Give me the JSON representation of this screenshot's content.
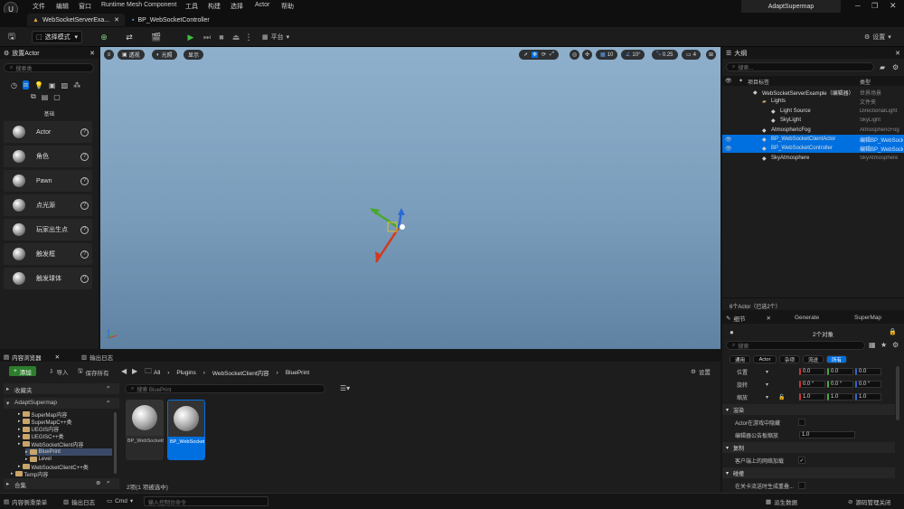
{
  "menu": {
    "items": [
      "文件",
      "编辑",
      "窗口",
      "Runtime Mesh Component",
      "工具",
      "构建",
      "选择",
      "Actor",
      "帮助"
    ],
    "project": "AdaptSupermap"
  },
  "tabs": {
    "level_tab": "WebSocketServerExa...",
    "blueprint_tab": "BP_WebSocketController"
  },
  "toolbar": {
    "select_mode": "选择模式",
    "platform": "平台",
    "settings": "设置"
  },
  "place_actors": {
    "title": "放置Actor",
    "search_placeholder": "搜索类",
    "category_label": "基础",
    "items": [
      {
        "label": "Actor",
        "icon": "sphere-icon"
      },
      {
        "label": "角色",
        "icon": "character-icon"
      },
      {
        "label": "Pawn",
        "icon": "pawn-icon"
      },
      {
        "label": "点光源",
        "icon": "point-light-icon"
      },
      {
        "label": "玩家出生点",
        "icon": "player-start-icon"
      },
      {
        "label": "触发框",
        "icon": "trigger-box-icon"
      },
      {
        "label": "触发球体",
        "icon": "trigger-sphere-icon"
      }
    ]
  },
  "viewport": {
    "view_mode": "透视",
    "lit_mode": "光照",
    "show": "显示",
    "grid_snap": "10",
    "rot_snap": "10°",
    "scale_snap": "0.25",
    "camera_speed": "4"
  },
  "outliner": {
    "title": "大纲",
    "search_placeholder": "搜索...",
    "col_label": "项目标签",
    "col_type": "类型",
    "rows": [
      {
        "name": "WebSocketServerExample（编辑器）",
        "type": "世界场景",
        "indent": 2,
        "selected": false,
        "visible": false
      },
      {
        "name": "Lights",
        "type": "文件夹",
        "indent": 3,
        "selected": false,
        "visible": false
      },
      {
        "name": "Light Source",
        "type": "DirectionalLight",
        "indent": 4,
        "selected": false,
        "visible": false
      },
      {
        "name": "SkyLight",
        "type": "SkyLight",
        "indent": 4,
        "selected": false,
        "visible": false
      },
      {
        "name": "AtmosphericFog",
        "type": "AtmosphericFog",
        "indent": 3,
        "selected": false,
        "visible": false
      },
      {
        "name": "BP_WebSocketClientActor",
        "type": "编辑BP_WebSocketClientActor",
        "indent": 3,
        "selected": true,
        "visible": true
      },
      {
        "name": "BP_WebSocketController",
        "type": "编辑BP_WebSocketController",
        "indent": 3,
        "selected": true,
        "visible": true
      },
      {
        "name": "SkyAtmosphere",
        "type": "SkyAtmosphere",
        "indent": 3,
        "selected": false,
        "visible": false
      }
    ],
    "footer": "6个Actor（已选2个）"
  },
  "details": {
    "tabs": [
      "细节",
      "Generate",
      "SuperMap"
    ],
    "object_count": "2个对象",
    "search_placeholder": "搜索",
    "filter_tabs": [
      "通用",
      "Actor",
      "杂项",
      "流送",
      "所有"
    ],
    "transform": {
      "location_label": "位置",
      "rotation_label": "旋转",
      "scale_label": "缩放",
      "location": [
        "0.0",
        "0.0",
        "0.0"
      ],
      "rotation": [
        "0.0 °",
        "0.0 °",
        "0.0 °"
      ],
      "scale": [
        "1.0",
        "1.0",
        "1.0"
      ]
    },
    "render_section": "渲染",
    "hidden_in_game": "Actor在游戏中隐藏",
    "billboard_scale_label": "编辑器公告板缩放",
    "billboard_scale": "1.0",
    "replication_section": "复制",
    "net_load_label": "客户端上的网络加载",
    "collision_section": "碰撞",
    "collision_label": "在关卡流送时生成重叠..."
  },
  "content_browser": {
    "tab_title": "内容浏览器",
    "log_tab": "输出日志",
    "add": "添加",
    "import": "导入",
    "save_all": "保存所有",
    "breadcrumb": [
      "All",
      "Plugins",
      "WebSocketClient内容",
      "BluePrint"
    ],
    "settings": "设置",
    "favorites": "收藏夹",
    "project": "AdaptSupermap",
    "search_placeholder": "搜索 BluePrint",
    "folders": [
      {
        "name": "SuperMap内容",
        "indent": 2,
        "selected": false
      },
      {
        "name": "SuperMapC++类",
        "indent": 2,
        "selected": false
      },
      {
        "name": "UEGIS内容",
        "indent": 2,
        "selected": false
      },
      {
        "name": "UEGISC++类",
        "indent": 2,
        "selected": false
      },
      {
        "name": "WebSocketClient内容",
        "indent": 2,
        "selected": false
      },
      {
        "name": "BluePrint",
        "indent": 3,
        "selected": true
      },
      {
        "name": "Level",
        "indent": 3,
        "selected": false
      },
      {
        "name": "WebSocketClientC++类",
        "indent": 2,
        "selected": false
      },
      {
        "name": "Temp内容",
        "indent": 1,
        "selected": false
      }
    ],
    "collections": "合集",
    "assets": [
      {
        "name": "BP_WebSocketClientActor",
        "selected": false
      },
      {
        "name": "BP_WebSocketController",
        "selected": true
      }
    ],
    "item_count": "2项(1 项被选中)"
  },
  "status": {
    "drawer": "内容侧滑菜单",
    "log": "输出日志",
    "cmd": "Cmd",
    "cmd_placeholder": "输入控制台命令",
    "derived_data": "派生数据",
    "source_control": "源码管理关闭"
  },
  "colors": {
    "accent": "#0070e0",
    "add_button": "#2d7d2d",
    "play_green": "#3fbf3f"
  }
}
